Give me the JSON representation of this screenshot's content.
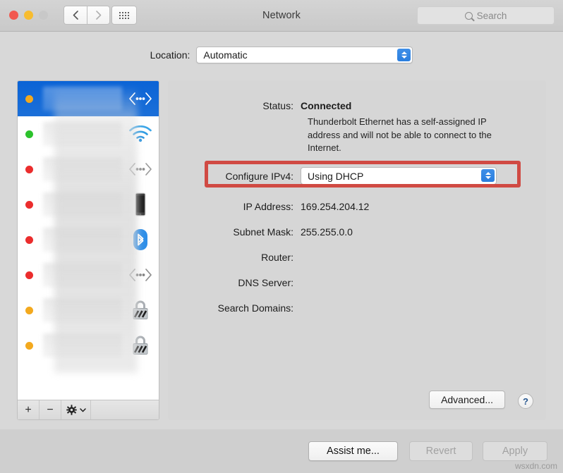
{
  "window": {
    "title": "Network",
    "traffic_lights": [
      "close",
      "minimize",
      "zoom"
    ],
    "nav_back_icon": "chevron-left-icon",
    "nav_forward_icon": "chevron-right-icon",
    "grid_icon": "show-all-grid-icon"
  },
  "search": {
    "placeholder": "Search",
    "icon": "search-icon"
  },
  "location": {
    "label": "Location:",
    "value": "Automatic",
    "options": [
      "Automatic"
    ]
  },
  "sidebar": {
    "services": [
      {
        "status": "orange",
        "icon": "thunderbolt-ethernet-icon",
        "selected": true
      },
      {
        "status": "green",
        "icon": "wifi-icon",
        "selected": false
      },
      {
        "status": "red",
        "icon": "thunderbolt-ethernet-icon",
        "selected": false
      },
      {
        "status": "red",
        "icon": "iphone-usb-icon",
        "selected": false
      },
      {
        "status": "red",
        "icon": "bluetooth-icon",
        "selected": false
      },
      {
        "status": "red",
        "icon": "thunderbolt-ethernet-icon",
        "selected": false
      },
      {
        "status": "orange",
        "icon": "vpn-lock-icon",
        "selected": false
      },
      {
        "status": "orange",
        "icon": "vpn-lock-icon",
        "selected": false
      }
    ],
    "toolbar": {
      "add_label": "+",
      "remove_label": "−",
      "gear_label": "⚙",
      "gear_chevron": "⌄"
    }
  },
  "main": {
    "fields": [
      {
        "label": "Status:",
        "value": "Connected",
        "bold": true
      },
      {
        "label": "Configure IPv4:",
        "value": "Using DHCP",
        "bold": false
      },
      {
        "label": "IP Address:",
        "value": "169.254.204.12",
        "bold": false
      },
      {
        "label": "Subnet Mask:",
        "value": "255.255.0.0",
        "bold": false
      },
      {
        "label": "Router:",
        "value": "",
        "bold": false
      },
      {
        "label": "DNS Server:",
        "value": "",
        "bold": false
      },
      {
        "label": "Search Domains:",
        "value": "",
        "bold": false
      }
    ],
    "status_description": "Thunderbolt Ethernet has a self-assigned IP address and will not be able to connect to the Internet.",
    "configure_ipv4_options": [
      "Using DHCP"
    ],
    "advanced_label": "Advanced...",
    "help_label": "?",
    "highlight_color": "#d04a43"
  },
  "footer": {
    "assist_label": "Assist me...",
    "revert_label": "Revert",
    "apply_label": "Apply",
    "revert_enabled": false,
    "apply_enabled": false
  },
  "watermark": "wsxdn.com"
}
